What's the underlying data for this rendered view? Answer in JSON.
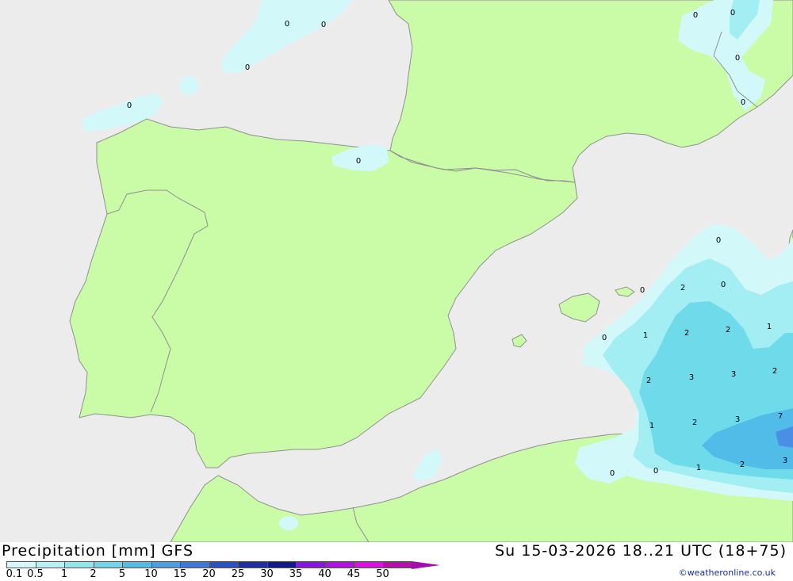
{
  "footer": {
    "title": "Precipitation [mm] GFS",
    "datetime": "Su 15-03-2026 18..21 UTC (18+75)",
    "credit": "©weatheronline.co.uk"
  },
  "legend": {
    "labels": [
      "0.1",
      "0.5",
      "1",
      "2",
      "5",
      "10",
      "15",
      "20",
      "25",
      "30",
      "35",
      "40",
      "45",
      "50"
    ],
    "colors": [
      "#d2f8fa",
      "#b4f0f4",
      "#8ee6ee",
      "#6ed6ea",
      "#52bce8",
      "#4a9ee6",
      "#3c78de",
      "#2a52c8",
      "#1c2eaa",
      "#16168e",
      "#8a14e6",
      "#b60ee6",
      "#e00ee6",
      "#b80eb0"
    ],
    "arrow_color": "#9e10a8"
  },
  "colors": {
    "sea": "#ececec",
    "land": "#cafca8",
    "border": "#909090",
    "precip_0": "#d2f8fa",
    "precip_1": "#a2eef2",
    "precip_2": "#6edaea",
    "precip_5": "#52bce8",
    "precip_10": "#4a8ee6"
  },
  "contour_labels": [
    {
      "text": "0"
    },
    {
      "text": "0"
    },
    {
      "text": "0"
    },
    {
      "text": "0"
    },
    {
      "text": "0"
    },
    {
      "text": "0"
    },
    {
      "text": "0"
    },
    {
      "text": "0"
    },
    {
      "text": "0"
    },
    {
      "text": "0"
    },
    {
      "text": "0"
    },
    {
      "text": "0"
    },
    {
      "text": "0"
    },
    {
      "text": "0"
    },
    {
      "text": "0"
    },
    {
      "text": "2"
    },
    {
      "text": "1"
    },
    {
      "text": "2"
    },
    {
      "text": "2"
    },
    {
      "text": "1"
    },
    {
      "text": "2"
    },
    {
      "text": "3"
    },
    {
      "text": "3"
    },
    {
      "text": "2"
    },
    {
      "text": "1"
    },
    {
      "text": "2"
    },
    {
      "text": "3"
    },
    {
      "text": "7"
    },
    {
      "text": "1"
    },
    {
      "text": "2"
    },
    {
      "text": "3"
    }
  ]
}
